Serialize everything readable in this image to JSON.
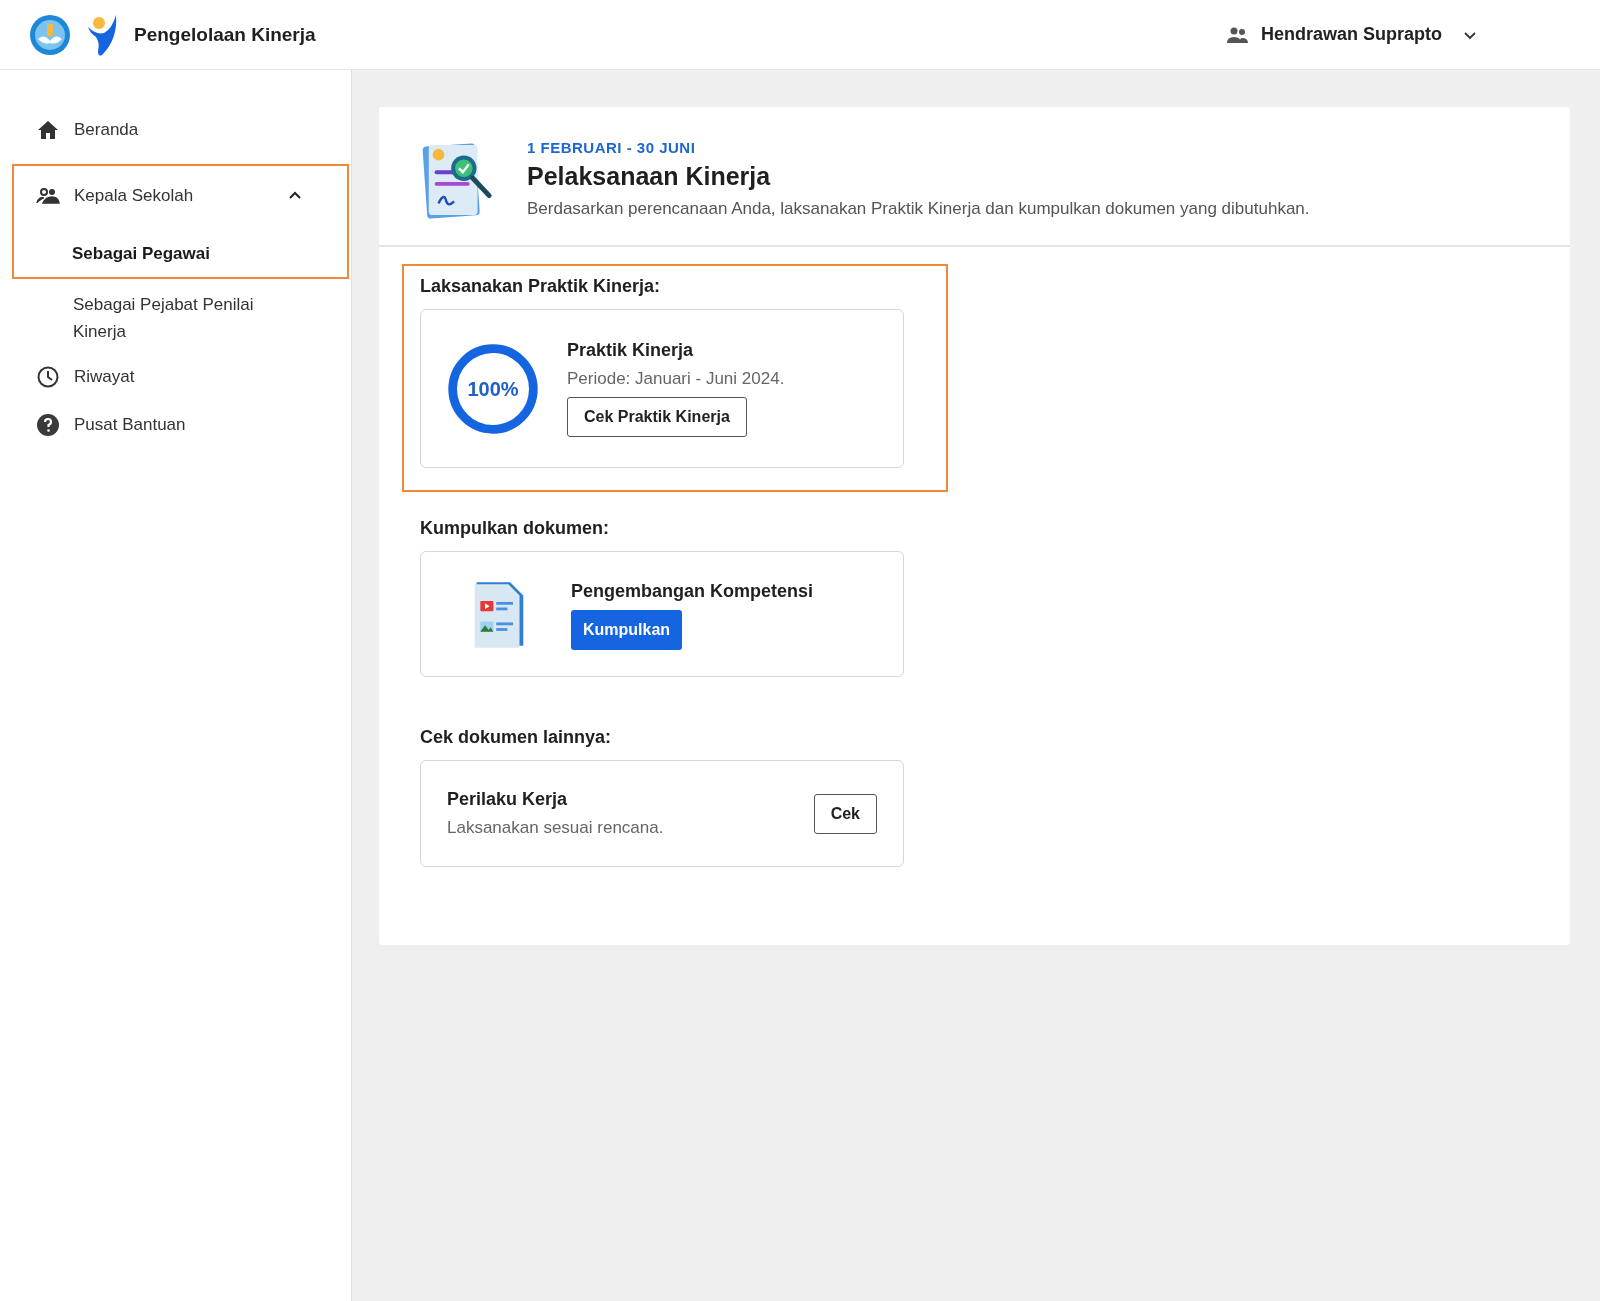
{
  "header": {
    "app_title": "Pengelolaan Kinerja",
    "user_name": "Hendrawan Suprapto"
  },
  "sidebar": {
    "items": [
      {
        "kind": "home",
        "label": "Beranda",
        "selected": false
      },
      {
        "kind": "group",
        "label": "Kepala Sekolah",
        "expanded": true,
        "highlighted": true,
        "children": [
          {
            "label": "Sebagai Pegawai",
            "selected": true,
            "highlighted": true
          },
          {
            "label": "Sebagai Pejabat Penilai Kinerja",
            "selected": false,
            "highlighted": false
          }
        ]
      },
      {
        "kind": "history",
        "label": "Riwayat",
        "selected": false
      },
      {
        "kind": "help",
        "label": "Pusat Bantuan",
        "selected": false
      }
    ]
  },
  "main": {
    "period": "1 FEBRUARI - 30 JUNI",
    "title": "Pelaksanaan Kinerja",
    "description": "Berdasarkan perencanaan Anda, laksanakan Praktik Kinerja dan kumpulkan dokumen yang dibutuhkan.",
    "sections": [
      {
        "kind": "progress",
        "heading": "Laksanakan Praktik Kinerja:",
        "highlighted": true,
        "card": {
          "title": "Praktik Kinerja",
          "subtitle": "Periode: Januari - Juni 2024.",
          "level": 1,
          "reading": "100%",
          "button": "Cek Praktik Kinerja"
        }
      },
      {
        "kind": "upload",
        "heading": "Kumpulkan dokumen:",
        "highlighted": false,
        "card": {
          "title": "Pengembangan Kompetensi",
          "button": "Kumpulkan"
        }
      },
      {
        "kind": "check",
        "heading": "Cek dokumen lainnya:",
        "highlighted": false,
        "card": {
          "title": "Perilaku Kerja",
          "subtitle": "Laksanakan sesuai rencana.",
          "button": "Cek"
        }
      }
    ]
  }
}
